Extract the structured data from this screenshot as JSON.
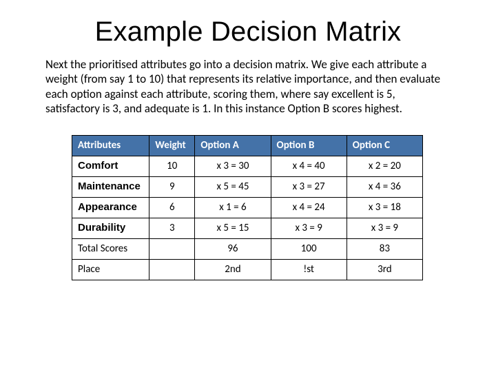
{
  "title": "Example Decision Matrix",
  "intro": "Next the prioritised attributes go into a decision matrix.  We give each attribute a weight (from say 1 to 10) that represents its relative importance, and then evaluate each option against each attribute, scoring them, where say excellent is 5, satisfactory is 3, and adequate is 1.  In this instance Option B scores highest.",
  "table": {
    "headers": {
      "attr": "Attributes",
      "weight": "Weight",
      "optA": "Option A",
      "optB": "Option B",
      "optC": "Option C"
    },
    "rows": [
      {
        "attr": "Comfort",
        "weight": "10",
        "a": "x 3 = 30",
        "b": "x 4 = 40",
        "c": "x 2 = 20"
      },
      {
        "attr": "Maintenance",
        "weight": "9",
        "a": "x 5 = 45",
        "b": "x 3 = 27",
        "c": "x 4 = 36"
      },
      {
        "attr": "Appearance",
        "weight": "6",
        "a": "x 1 = 6",
        "b": "x 4 = 24",
        "c": "x 3 = 18"
      },
      {
        "attr": "Durability",
        "weight": "3",
        "a": "x 5 = 15",
        "b": "x 3 = 9",
        "c": "x 3 = 9"
      }
    ],
    "totals": {
      "label": "Total Scores",
      "a": "96",
      "b": "100",
      "c": "83"
    },
    "places": {
      "label": "Place",
      "a": "2nd",
      "b": "!st",
      "c": "3rd"
    }
  },
  "chart_data": {
    "type": "table",
    "title": "Example Decision Matrix",
    "attributes": [
      {
        "name": "Comfort",
        "weight": 10,
        "optionA": {
          "score": 3,
          "total": 30
        },
        "optionB": {
          "score": 4,
          "total": 40
        },
        "optionC": {
          "score": 2,
          "total": 20
        }
      },
      {
        "name": "Maintenance",
        "weight": 9,
        "optionA": {
          "score": 5,
          "total": 45
        },
        "optionB": {
          "score": 3,
          "total": 27
        },
        "optionC": {
          "score": 4,
          "total": 36
        }
      },
      {
        "name": "Appearance",
        "weight": 6,
        "optionA": {
          "score": 1,
          "total": 6
        },
        "optionB": {
          "score": 4,
          "total": 24
        },
        "optionC": {
          "score": 3,
          "total": 18
        }
      },
      {
        "name": "Durability",
        "weight": 3,
        "optionA": {
          "score": 5,
          "total": 15
        },
        "optionB": {
          "score": 3,
          "total": 9
        },
        "optionC": {
          "score": 3,
          "total": 9
        }
      }
    ],
    "totals": {
      "optionA": 96,
      "optionB": 100,
      "optionC": 83
    },
    "places": {
      "optionA": "2nd",
      "optionB": "1st",
      "optionC": "3rd"
    }
  }
}
